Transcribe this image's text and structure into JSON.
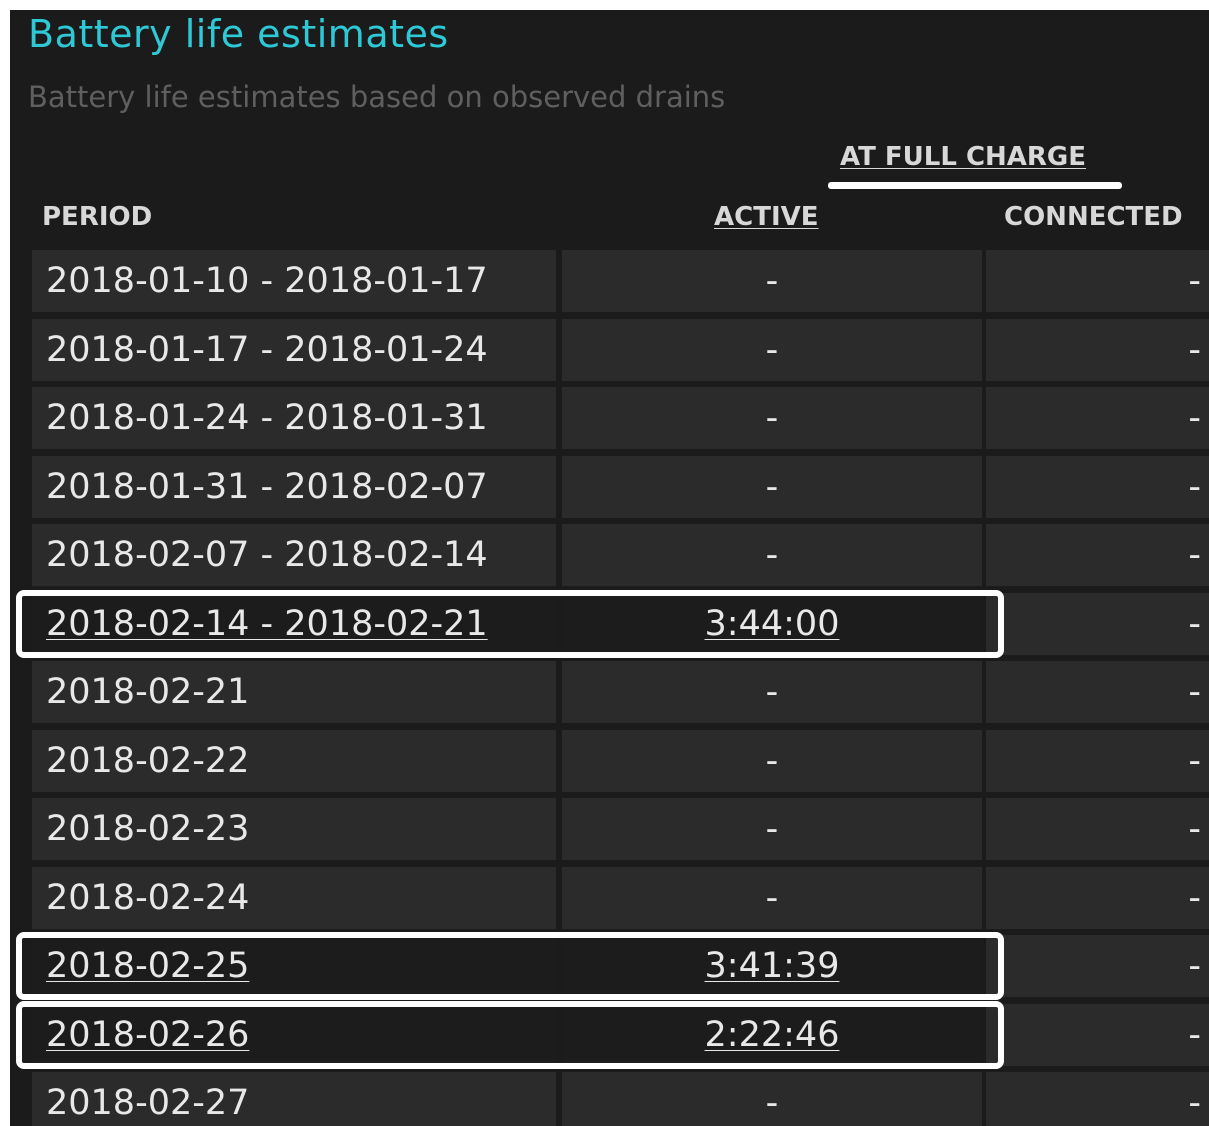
{
  "report": {
    "title": "Battery life estimates",
    "subtitle": "Battery life estimates based on observed drains",
    "group_header": "AT FULL CHARGE",
    "columns": {
      "period": "PERIOD",
      "active": "ACTIVE",
      "connected": "CONNECTED"
    },
    "rows": [
      {
        "period": "2018-01-10 - 2018-01-17",
        "active": "-",
        "connected": "-"
      },
      {
        "period": "2018-01-17 - 2018-01-24",
        "active": "-",
        "connected": "-"
      },
      {
        "period": "2018-01-24 - 2018-01-31",
        "active": "-",
        "connected": "-"
      },
      {
        "period": "2018-01-31 - 2018-02-07",
        "active": "-",
        "connected": "-"
      },
      {
        "period": "2018-02-07 - 2018-02-14",
        "active": "-",
        "connected": "-"
      },
      {
        "period": "2018-02-14 - 2018-02-21",
        "active": "3:44:00",
        "connected": "-",
        "highlighted": true
      },
      {
        "period": "2018-02-21",
        "active": "-",
        "connected": "-"
      },
      {
        "period": "2018-02-22",
        "active": "-",
        "connected": "-"
      },
      {
        "period": "2018-02-23",
        "active": "-",
        "connected": "-"
      },
      {
        "period": "2018-02-24",
        "active": "-",
        "connected": "-"
      },
      {
        "period": "2018-02-25",
        "active": "3:41:39",
        "connected": "-",
        "highlighted": true
      },
      {
        "period": "2018-02-26",
        "active": "2:22:46",
        "connected": "-",
        "highlighted": true
      },
      {
        "period": "2018-02-27",
        "active": "-",
        "connected": "-"
      }
    ]
  },
  "colors": {
    "title": "#2ec9d6",
    "background": "#1b1b1b",
    "cell": "#2b2b2b",
    "annotation": "#ffffff"
  }
}
